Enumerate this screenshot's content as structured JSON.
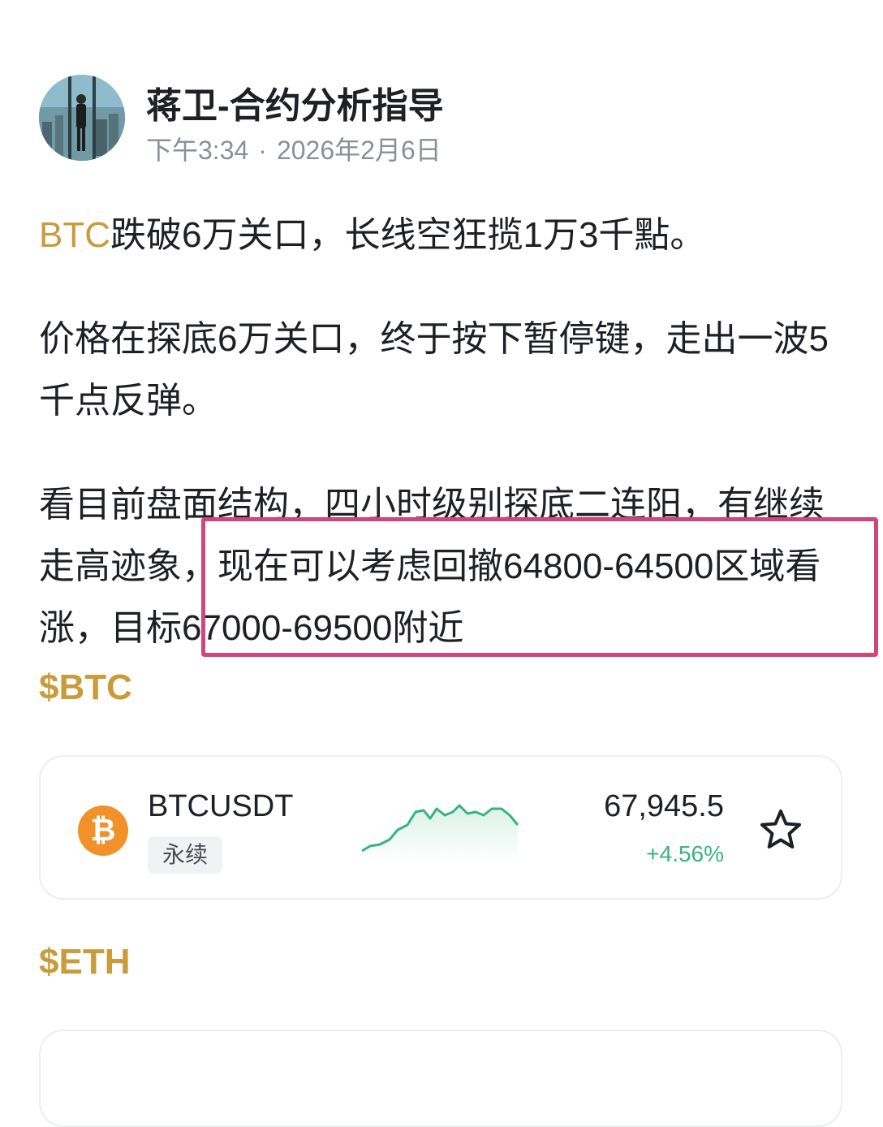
{
  "post": {
    "author": "蒋卫-合约分析指导",
    "time": "下午3:34",
    "separator": "·",
    "date": "2026年2月6日",
    "headline_coin": "BTC",
    "headline_rest": "跌破6万关口，长线空狂揽1万3千點。",
    "paragraph2": "价格在探底6万关口，终于按下暂停键，走出一波5千点反弹。",
    "paragraph3": "看目前盘面结构，四小时级别探底二连阳，有继续走高迹象，现在可以考虑回撤64800-64500区域看涨，目标67000-69500附近",
    "tag_btc": "$BTC",
    "tag_eth": "$ETH"
  },
  "ticker": {
    "symbol": "BTCUSDT",
    "contract_type": "永续",
    "coin_glyph": "₿",
    "price": "67,945.5",
    "change": "+4.56%",
    "change_color": "#37b47e",
    "coin_color": "#f2912a",
    "icons": {
      "coin": "bitcoin-icon",
      "favorite": "star-icon"
    }
  },
  "colors": {
    "accent": "#c99b3a",
    "highlight_border": "#d0457a"
  }
}
